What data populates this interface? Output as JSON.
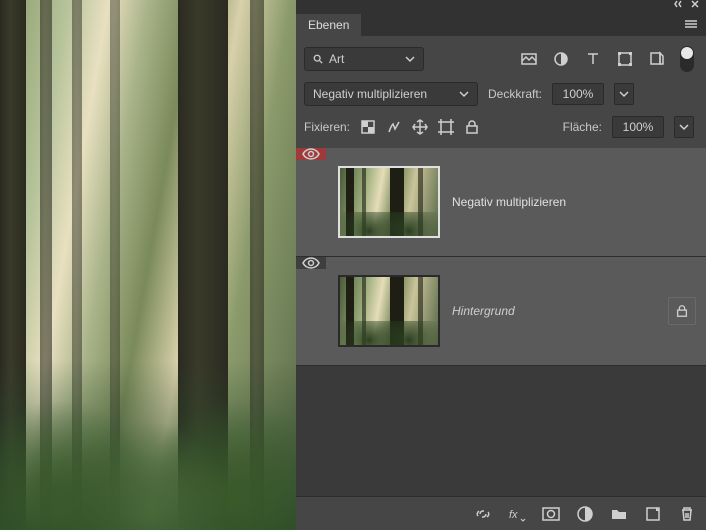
{
  "panel": {
    "tab_title": "Ebenen",
    "filter": {
      "search_label": "Art"
    },
    "blend_mode": "Negativ multiplizieren",
    "opacity": {
      "label": "Deckkraft:",
      "value": "100%"
    },
    "lock": {
      "label": "Fixieren:"
    },
    "fill": {
      "label": "Fläche:",
      "value": "100%"
    },
    "layers": [
      {
        "name": "Negativ multiplizieren",
        "visible": true,
        "selected": true,
        "locked": false
      },
      {
        "name": "Hintergrund",
        "visible": true,
        "selected": false,
        "locked": true
      }
    ]
  }
}
